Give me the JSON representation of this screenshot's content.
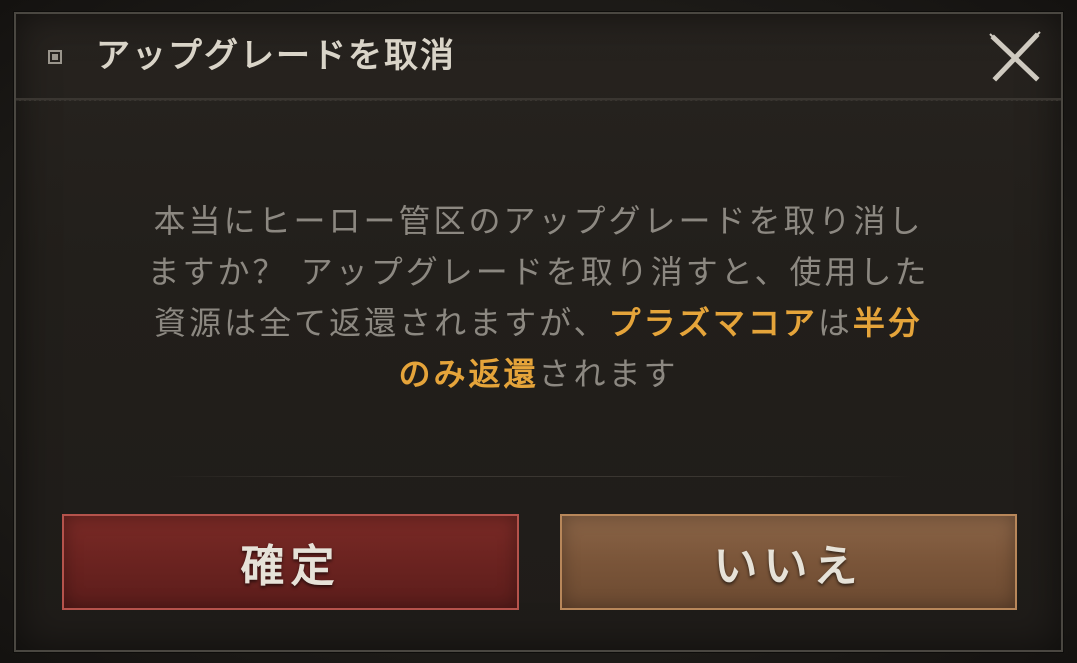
{
  "dialog": {
    "title": "アップグレードを取消",
    "close_icon": "close-x-icon",
    "message": {
      "line1": "本当にヒーロー管区のアップグレードを取り消し",
      "line2": "ますか？ アップグレードを取り消すと、使用した",
      "line3_a": "資源は全て返還されますが、",
      "line3_hl1": "プラズマコア",
      "line3_b": "は",
      "line3_hl2": "半分",
      "line4_hl": "のみ返還",
      "line4_b": "されます"
    },
    "confirm_label": "確定",
    "cancel_label": "いいえ"
  },
  "colors": {
    "highlight": "#e5a43a",
    "confirm_button": "#6b2320",
    "cancel_button": "#7a5539",
    "body_text": "#8c8881"
  }
}
